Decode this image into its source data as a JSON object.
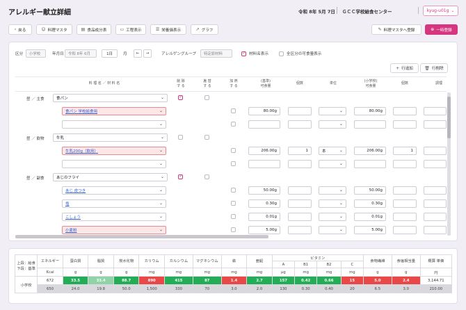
{
  "header": {
    "title": "アレルギー献立詳細",
    "date": "令和 8年 5月 7日",
    "center": "ＧＣＣ学校給食センター",
    "user": "kyug-u01g"
  },
  "toolbar": {
    "back": "戻る",
    "dish_master": "料理マスタ",
    "food_table": "食品成分表",
    "process": "工程表示",
    "nutrition": "栄養価表示",
    "graph": "グラフ",
    "register_dish": "料理マスタへ登録",
    "temp_save": "一時登録"
  },
  "filters": {
    "kubun_label": "区分",
    "kubun_value": "小学校",
    "year_label": "年月日",
    "year_value": "令和 8年 6月",
    "day_value": "1日",
    "youbi_label": "月",
    "prev": "←",
    "next": "→",
    "allergen_label": "アレルゲングループ",
    "allergen_value": "特定原材料",
    "show_material": "材料名表示",
    "show_all": "全区分の可食量表示"
  },
  "row_actions": {
    "add_row": "行追加",
    "delete_row": "行削除"
  },
  "columns": {
    "name": "料 理 名 ／ 材 料 名",
    "remove1": "削 除",
    "remove2": "す る",
    "substitute1": "差 替",
    "substitute2": "す る",
    "add1": "加 熱",
    "add2": "す る",
    "std1": "(基準)",
    "std2": "可食量",
    "count": "個数",
    "unit": "単位",
    "school1": "(小学校)",
    "school2": "可食量",
    "count2": "個数",
    "extra": "調理"
  },
  "rows": [
    {
      "group": "昼 ／ 主食",
      "name": "食パン",
      "type": "dish"
    },
    {
      "name": "食パン 学校給食用",
      "type": "item",
      "red": true,
      "link": true,
      "std": "80.00g",
      "count": "",
      "unit": "",
      "school": "80.00g",
      "count2": ""
    },
    {
      "name": "",
      "type": "item",
      "std": "",
      "school": ""
    },
    {
      "group": "昼 ／ 飲物",
      "name": "牛乳",
      "type": "dish"
    },
    {
      "name": "牛乳200g（飲用）",
      "type": "item",
      "red": true,
      "link": true,
      "std": "206.00g",
      "count": "1",
      "unit": "本",
      "school": "206.00g",
      "count2": "1"
    },
    {
      "name": "",
      "type": "item",
      "std": "",
      "school": ""
    },
    {
      "group": "昼 ／ 副食",
      "name": "あじのフライ",
      "type": "dish"
    },
    {
      "name": "あじ 皮つき",
      "type": "item",
      "link": true,
      "std": "50.00g",
      "school": "50.00g"
    },
    {
      "name": "塩",
      "type": "item",
      "link": true,
      "std": "0.30g",
      "school": "0.30g"
    },
    {
      "name": "こしょう",
      "type": "item",
      "link": true,
      "std": "0.01g",
      "school": "0.01g"
    },
    {
      "name": "小麦粉",
      "type": "item",
      "red": true,
      "link": true,
      "std": "5.00g",
      "school": "5.00g"
    }
  ],
  "nutrition": {
    "corner1": "上段：給食",
    "corner2": "下段：基準",
    "vitamin_header": "ビタミン",
    "headers": [
      "エネルギー",
      "蛋白質",
      "脂質",
      "炭水化物",
      "カリウム",
      "カルシウム",
      "マグネシウム",
      "鉄",
      "亜鉛",
      "A",
      "B1",
      "B2",
      "C",
      "食物繊維",
      "食塩相当量",
      "概算 単価"
    ],
    "units": [
      "Kcal",
      "g",
      "g",
      "g",
      "mg",
      "mg",
      "mg",
      "mg",
      "mg",
      "μg",
      "mg",
      "mg",
      "mg",
      "g",
      "g",
      "円"
    ],
    "row_label": "小学校",
    "actual": [
      "672",
      "33.5",
      "33.4",
      "88.7",
      "890",
      "415",
      "87",
      "1.4",
      "2.7",
      "157",
      "0.42",
      "0.66",
      "15",
      "5.0",
      "2.4",
      "3,144.71"
    ],
    "standard": [
      "650",
      "24.0",
      "19.8",
      "50.0",
      "1,500",
      "330",
      "70",
      "3.0",
      "2.0",
      "130",
      "0.30",
      "0.40",
      "20",
      "6.5",
      "3.0",
      "210.00"
    ],
    "colors": [
      "#ffffff",
      "#23ad57",
      "#8fd3a6",
      "#23ad57",
      "#e84848",
      "#23ad57",
      "#23ad57",
      "#e84848",
      "#23ad57",
      "#23ad57",
      "#23ad57",
      "#23ad57",
      "#e84848",
      "#e84848",
      "#e84848",
      "#ffffff"
    ]
  },
  "colors": {
    "accent": "#d6357f",
    "link": "#2f5fd0",
    "ok": "#23ad57",
    "warn": "#e84848"
  }
}
